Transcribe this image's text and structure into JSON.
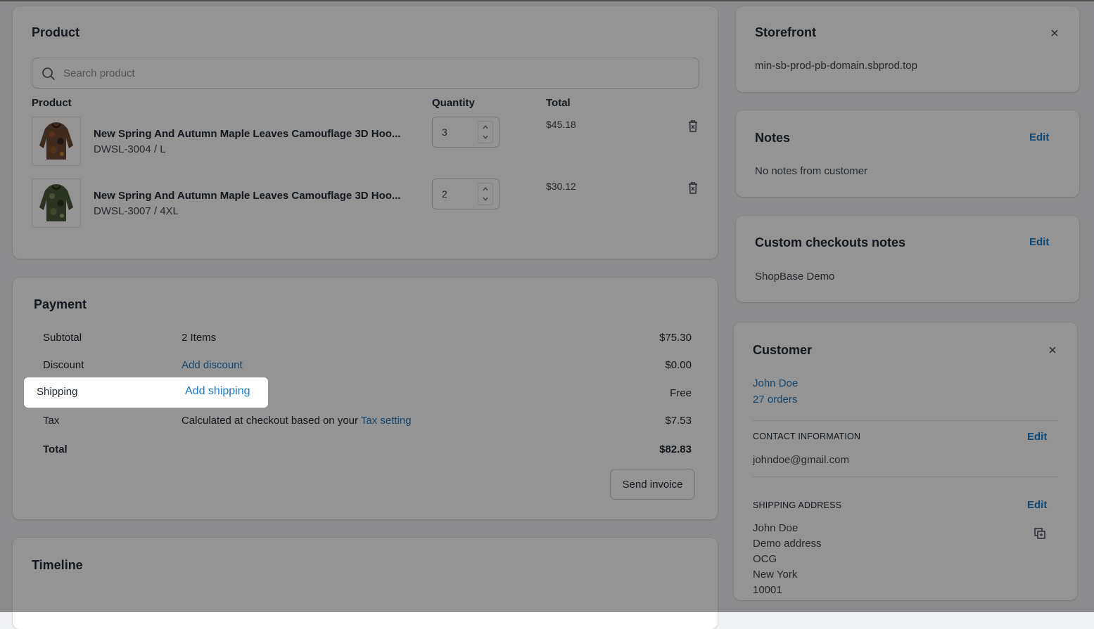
{
  "product": {
    "title": "Product",
    "search_placeholder": "Search product",
    "columns": {
      "product": "Product",
      "quantity": "Quantity",
      "total": "Total"
    },
    "items": [
      {
        "name": "New Spring And Autumn Maple Leaves Camouflage 3D Hoo...",
        "variant": "DWSL-3004 / L",
        "quantity": "3",
        "total": "$45.18"
      },
      {
        "name": "New Spring And Autumn Maple Leaves Camouflage 3D Hoo...",
        "variant": "DWSL-3007 / 4XL",
        "quantity": "2",
        "total": "$30.12"
      }
    ]
  },
  "payment": {
    "title": "Payment",
    "subtotal": {
      "label": "Subtotal",
      "detail": "2 Items",
      "amount": "$75.30"
    },
    "discount": {
      "label": "Discount",
      "link": "Add discount",
      "amount": "$0.00"
    },
    "shipping": {
      "label": "Shipping",
      "link": "Add shipping",
      "amount": "Free"
    },
    "tax": {
      "label": "Tax",
      "detail": "Calculated at checkout based on your",
      "link": "Tax setting",
      "amount": "$7.53"
    },
    "total": {
      "label": "Total",
      "amount": "$82.83"
    },
    "send_invoice": "Send invoice"
  },
  "timeline": {
    "title": "Timeline"
  },
  "storefront": {
    "title": "Storefront",
    "domain": "min-sb-prod-pb-domain.sbprod.top"
  },
  "notes": {
    "title": "Notes",
    "edit": "Edit",
    "text": "No notes from customer"
  },
  "custom_notes": {
    "title": "Custom checkouts notes",
    "edit": "Edit",
    "text": "ShopBase Demo"
  },
  "customer": {
    "title": "Customer",
    "name": "John Doe",
    "orders": "27 orders",
    "contact_heading": "CONTACT INFORMATION",
    "contact_edit": "Edit",
    "email": "johndoe@gmail.com",
    "shipping_heading": "SHIPPING ADDRESS",
    "shipping_edit": "Edit",
    "address": [
      "John Doe",
      "Demo address",
      "OCG",
      "New York",
      "10001"
    ]
  },
  "colors": {
    "link": "#1b7ac8",
    "overlay": "rgba(0,0,0,0.42)"
  }
}
